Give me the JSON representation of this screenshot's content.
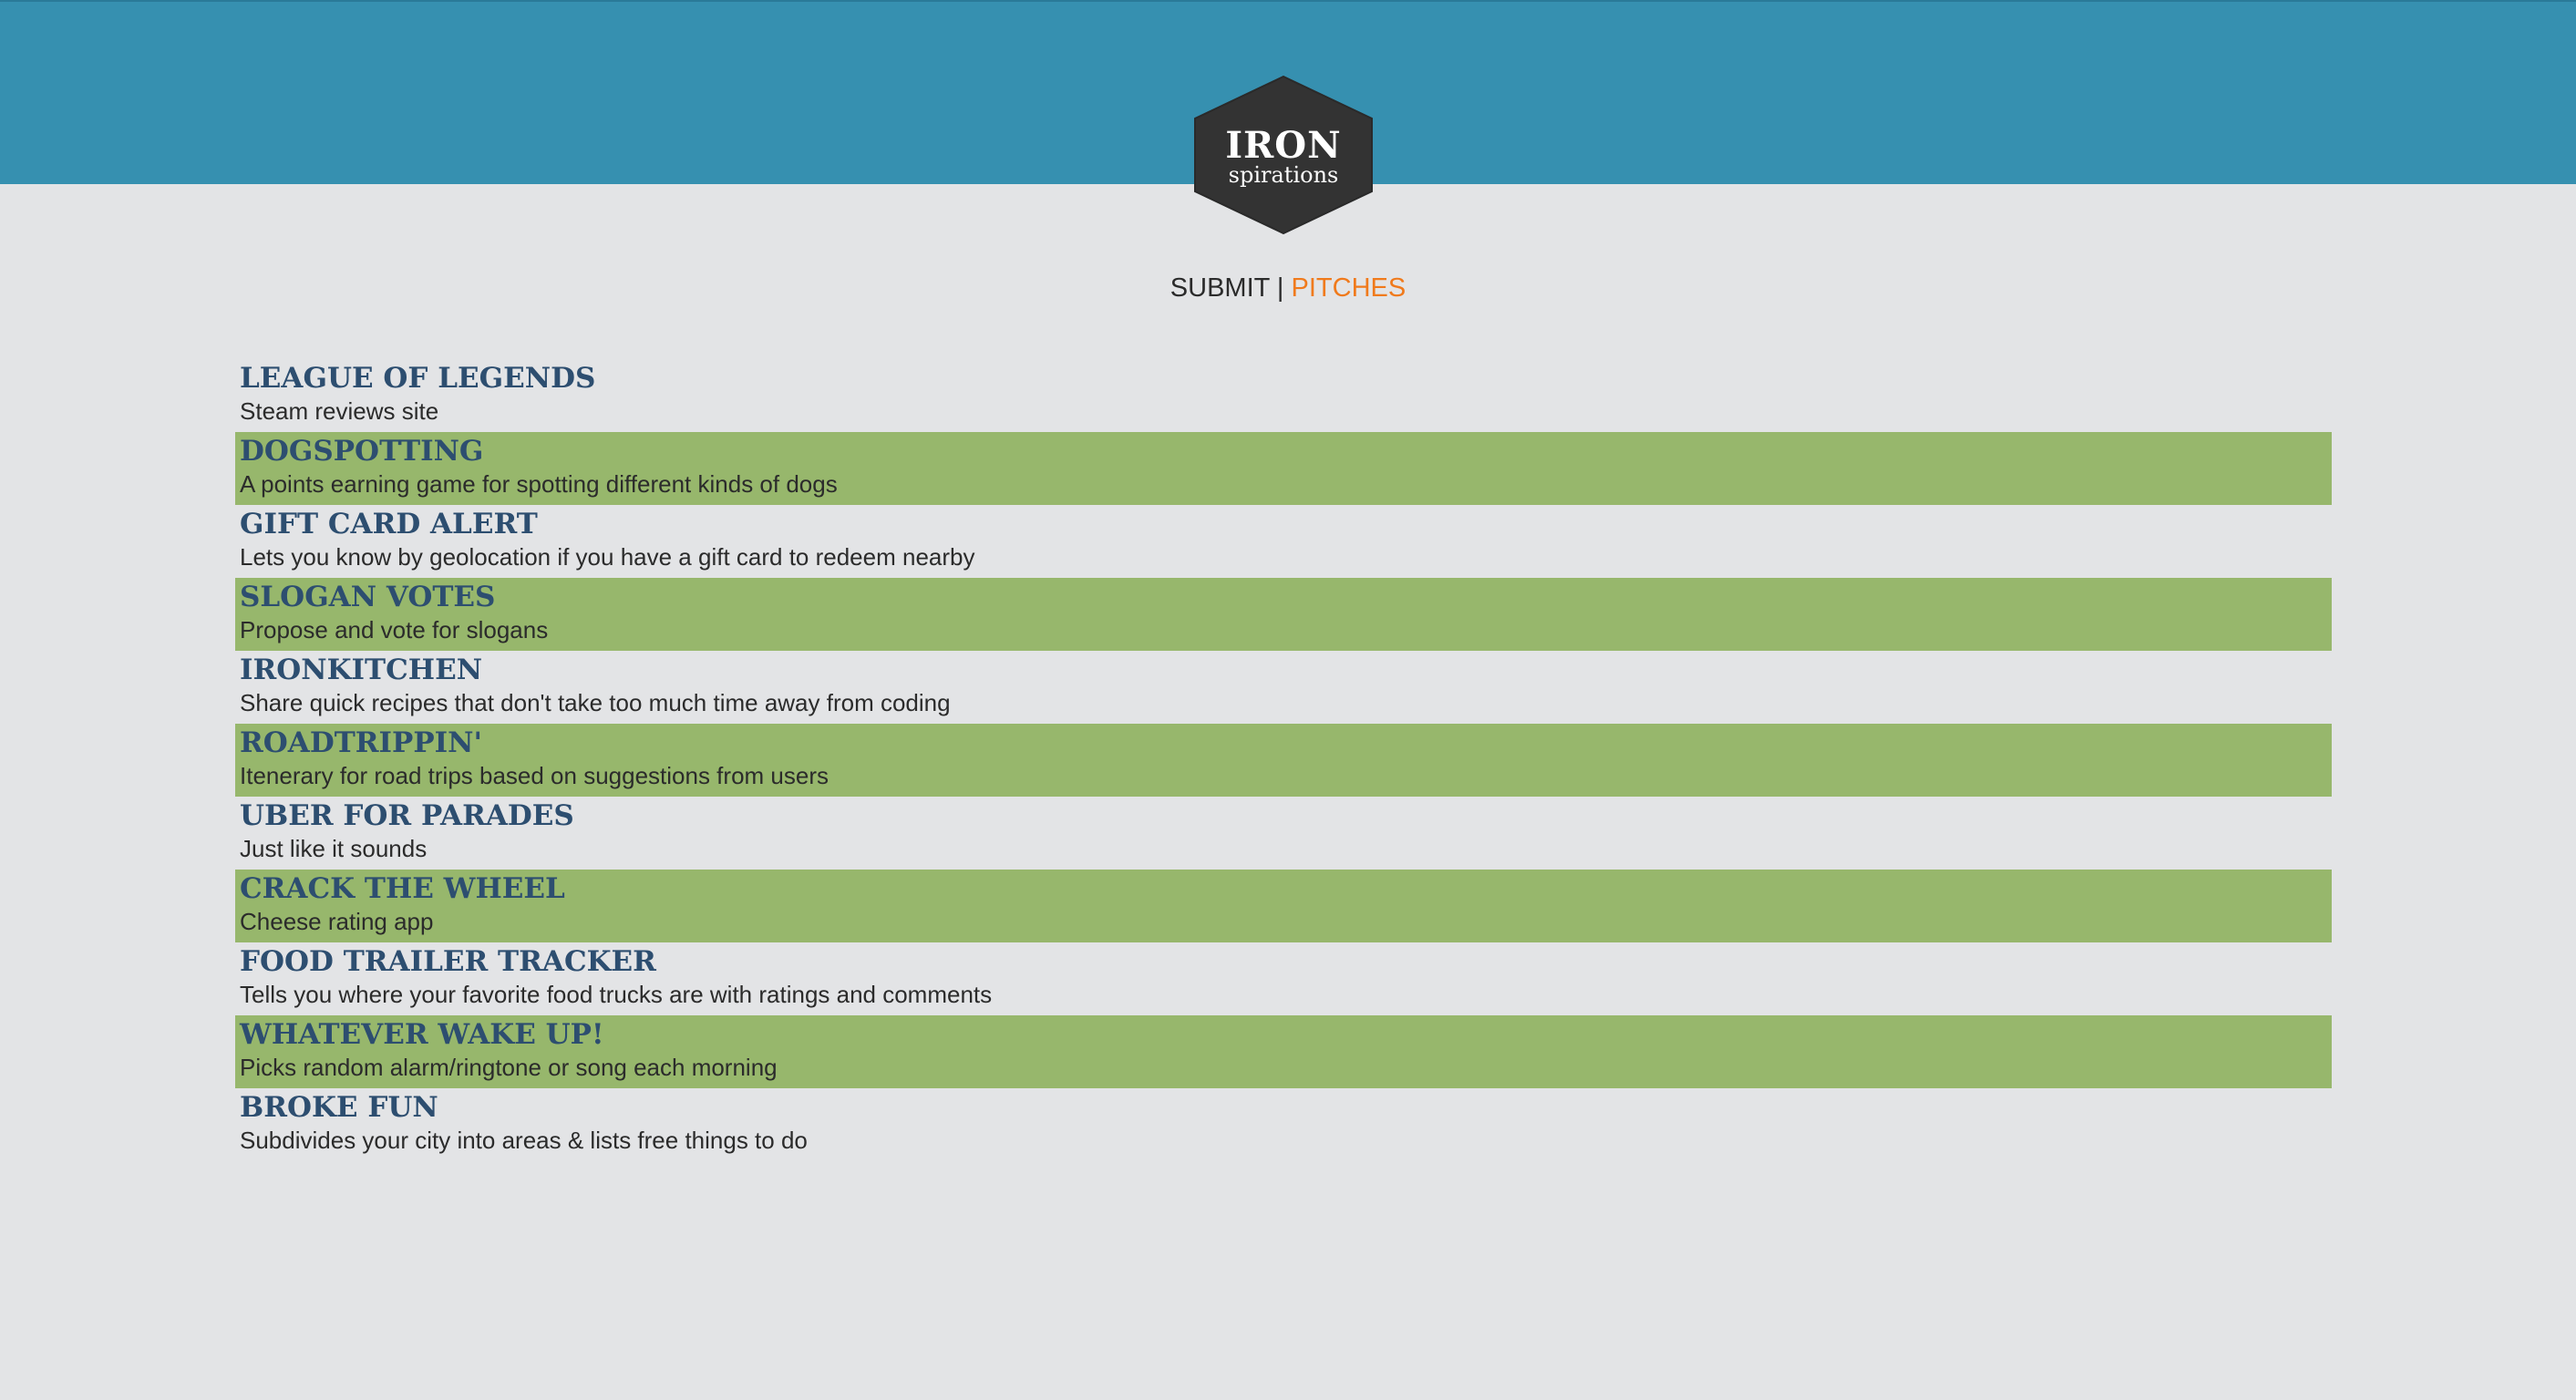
{
  "logo": {
    "title": "IRON",
    "subtitle": "spirations"
  },
  "nav": {
    "submit_label": "SUBMIT",
    "separator": "|",
    "pitches_label": "PITCHES"
  },
  "colors": {
    "header": "#3690b0",
    "background": "#e3e4e6",
    "row_highlight": "#97b76c",
    "title_text": "#2d4e70",
    "nav_active": "#f07a1c",
    "logo_fill": "#333333"
  },
  "pitches": [
    {
      "title": "LEAGUE OF LEGENDS",
      "description": "Steam reviews site"
    },
    {
      "title": "DOGSPOTTING",
      "description": "A points earning game for spotting different kinds of dogs"
    },
    {
      "title": "GIFT CARD ALERT",
      "description": "Lets you know by geolocation if you have a gift card to redeem nearby"
    },
    {
      "title": "SLOGAN VOTES",
      "description": "Propose and vote for slogans"
    },
    {
      "title": "IRONKITCHEN",
      "description": "Share quick recipes that don't take too much time away from coding"
    },
    {
      "title": "ROADTRIPPIN'",
      "description": "Itenerary for road trips based on suggestions from users"
    },
    {
      "title": "UBER FOR PARADES",
      "description": "Just like it sounds"
    },
    {
      "title": "CRACK THE WHEEL",
      "description": "Cheese rating app"
    },
    {
      "title": "FOOD TRAILER TRACKER",
      "description": "Tells you where your favorite food trucks are with ratings and comments"
    },
    {
      "title": "WHATEVER WAKE UP!",
      "description": "Picks random alarm/ringtone or song each morning"
    },
    {
      "title": "BROKE FUN",
      "description": "Subdivides your city into areas & lists free things to do"
    }
  ]
}
